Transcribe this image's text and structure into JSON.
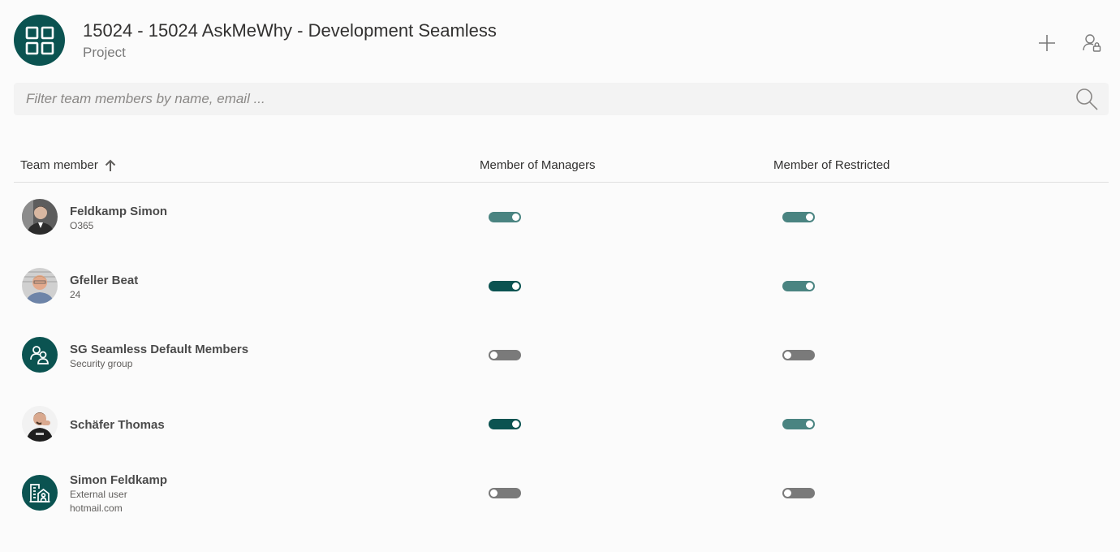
{
  "header": {
    "title": "15024 - 15024 AskMeWhy - Development Seamless",
    "subtitle": "Project",
    "project_icon": "grid-icon",
    "add_icon": "plus-icon",
    "manage_icon": "person-lock-icon"
  },
  "search": {
    "placeholder": "Filter team members by name, email ...",
    "value": "",
    "icon": "search-icon"
  },
  "table": {
    "columns": {
      "member": "Team member",
      "managers": "Member of Managers",
      "restricted": "Member of Restricted"
    },
    "sort_icon": "arrow-up-icon",
    "rows": [
      {
        "name": "Feldkamp Simon",
        "sub": "O365",
        "sub2": "",
        "avatar": "photo",
        "managers": "on-light",
        "restricted": "on-light"
      },
      {
        "name": "Gfeller Beat",
        "sub": "24",
        "sub2": "",
        "avatar": "photo",
        "managers": "on-dark",
        "restricted": "on-light"
      },
      {
        "name": "SG Seamless Default Members",
        "sub": "Security group",
        "sub2": "",
        "avatar": "people-group-icon",
        "managers": "off",
        "restricted": "off"
      },
      {
        "name": "Schäfer Thomas",
        "sub": "",
        "sub2": "",
        "avatar": "photo",
        "managers": "on-dark",
        "restricted": "on-light"
      },
      {
        "name": "Simon Feldkamp",
        "sub": "External user",
        "sub2": "hotmail.com",
        "avatar": "building-person-icon",
        "managers": "off",
        "restricted": "off"
      }
    ]
  },
  "colors": {
    "brand": "#0b5351",
    "toggle_on_dark": "#0b5351",
    "toggle_on_light": "#4a8481",
    "toggle_off": "#7a7a7a"
  }
}
